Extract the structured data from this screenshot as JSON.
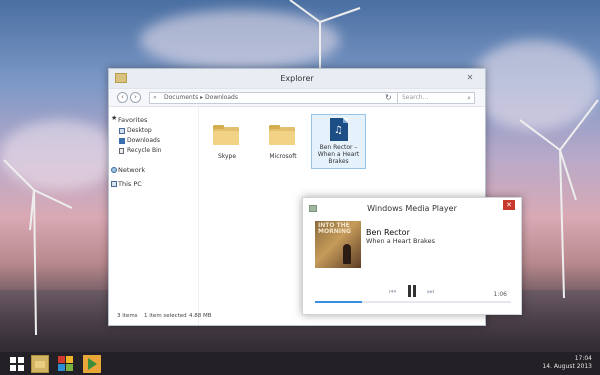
{
  "explorer": {
    "title": "Explorer",
    "address_path": "Documents ▸ Downloads",
    "search_placeholder": "Search...",
    "sidebar": {
      "favorites_label": "Favorites",
      "favorites": [
        {
          "label": "Desktop",
          "icon": "desktop-icon"
        },
        {
          "label": "Downloads",
          "icon": "downloads-icon"
        },
        {
          "label": "Recycle Bin",
          "icon": "recycle-bin-icon"
        }
      ],
      "network_label": "Network",
      "this_pc_label": "This PC"
    },
    "files": [
      {
        "name": "Skype",
        "type": "folder",
        "selected": false
      },
      {
        "name": "Microsoft",
        "type": "folder",
        "selected": false
      },
      {
        "name": "Ben Rector – When a Heart Brakes",
        "type": "audio",
        "selected": true
      }
    ],
    "status": {
      "items_count": "3 items",
      "selected_info": "1 item selected",
      "selected_size": "4.88 MB"
    }
  },
  "media_player": {
    "title": "Windows Media Player",
    "artist": "Ben Rector",
    "track": "When a Heart Brakes",
    "album_art_text": "INTO THE MORNING",
    "time": "1:06",
    "progress": 0.24
  },
  "taskbar": {
    "time": "17:04",
    "date": "14. August 2013"
  },
  "colors": {
    "accent_blue": "#3a8ee0",
    "close_red": "#c7392b",
    "folder_yellow": "#f2d385"
  }
}
